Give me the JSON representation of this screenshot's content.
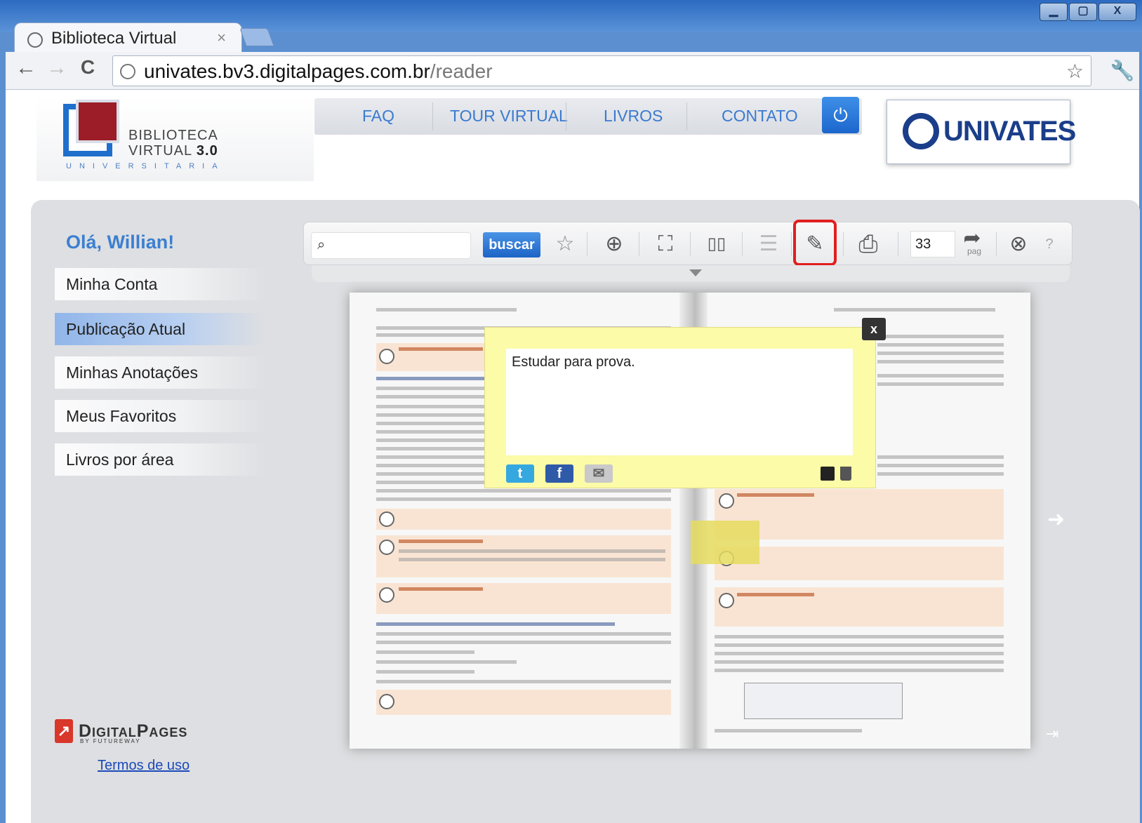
{
  "browser": {
    "tab_title": "Biblioteca Virtual",
    "tab_close": "×",
    "url_host": "univates.bv3.digitalpages.com.br",
    "url_path": "/reader",
    "back": "←",
    "forward": "→",
    "reload": "C",
    "star": "☆",
    "wrench": "🔧",
    "window_min": "▁",
    "window_max": "▢",
    "window_close": "X"
  },
  "header": {
    "logo_line1": "BIBLIOTECA",
    "logo_line2_a": "VIRTUAL ",
    "logo_line2_b": "3.0",
    "logo_line3": "UNIVERSITARIA",
    "menu": [
      "FAQ",
      "TOUR VIRTUAL",
      "LIVROS",
      "CONTATO"
    ],
    "power": "⏻",
    "partner": "UNIVATES"
  },
  "sidebar": {
    "greeting": "Olá, Willian!",
    "items": [
      {
        "label": "Minha Conta"
      },
      {
        "label": "Publicação Atual"
      },
      {
        "label": "Minhas Anotações"
      },
      {
        "label": "Meus Favoritos"
      },
      {
        "label": "Livros por área"
      }
    ],
    "brand_icon": "↗",
    "brand": "DigitalPages",
    "brand_sub": "BY FUTUREWAY",
    "terms": "Termos de uso"
  },
  "reader": {
    "search_icon": "⌕",
    "search_placeholder": "",
    "search_button": "buscar",
    "page_number": "33",
    "page_label": "pag",
    "icons": {
      "favorite": "☆",
      "zoom": "⊕",
      "fullscreen": "⛶",
      "double_page": "▯▯",
      "index": "☰",
      "notes": "✎",
      "print": "⎙",
      "goto": "➦",
      "close": "⊗",
      "help": "?"
    },
    "next_page": "➜",
    "last_page": "⇥"
  },
  "note": {
    "text": "Estudar para prova.",
    "close": "x",
    "twitter": "t",
    "facebook": "f",
    "email": "✉"
  },
  "colors": {
    "accent": "#3b7fd0",
    "highlight_border": "#e0201f",
    "note_bg": "#fcfba8"
  }
}
